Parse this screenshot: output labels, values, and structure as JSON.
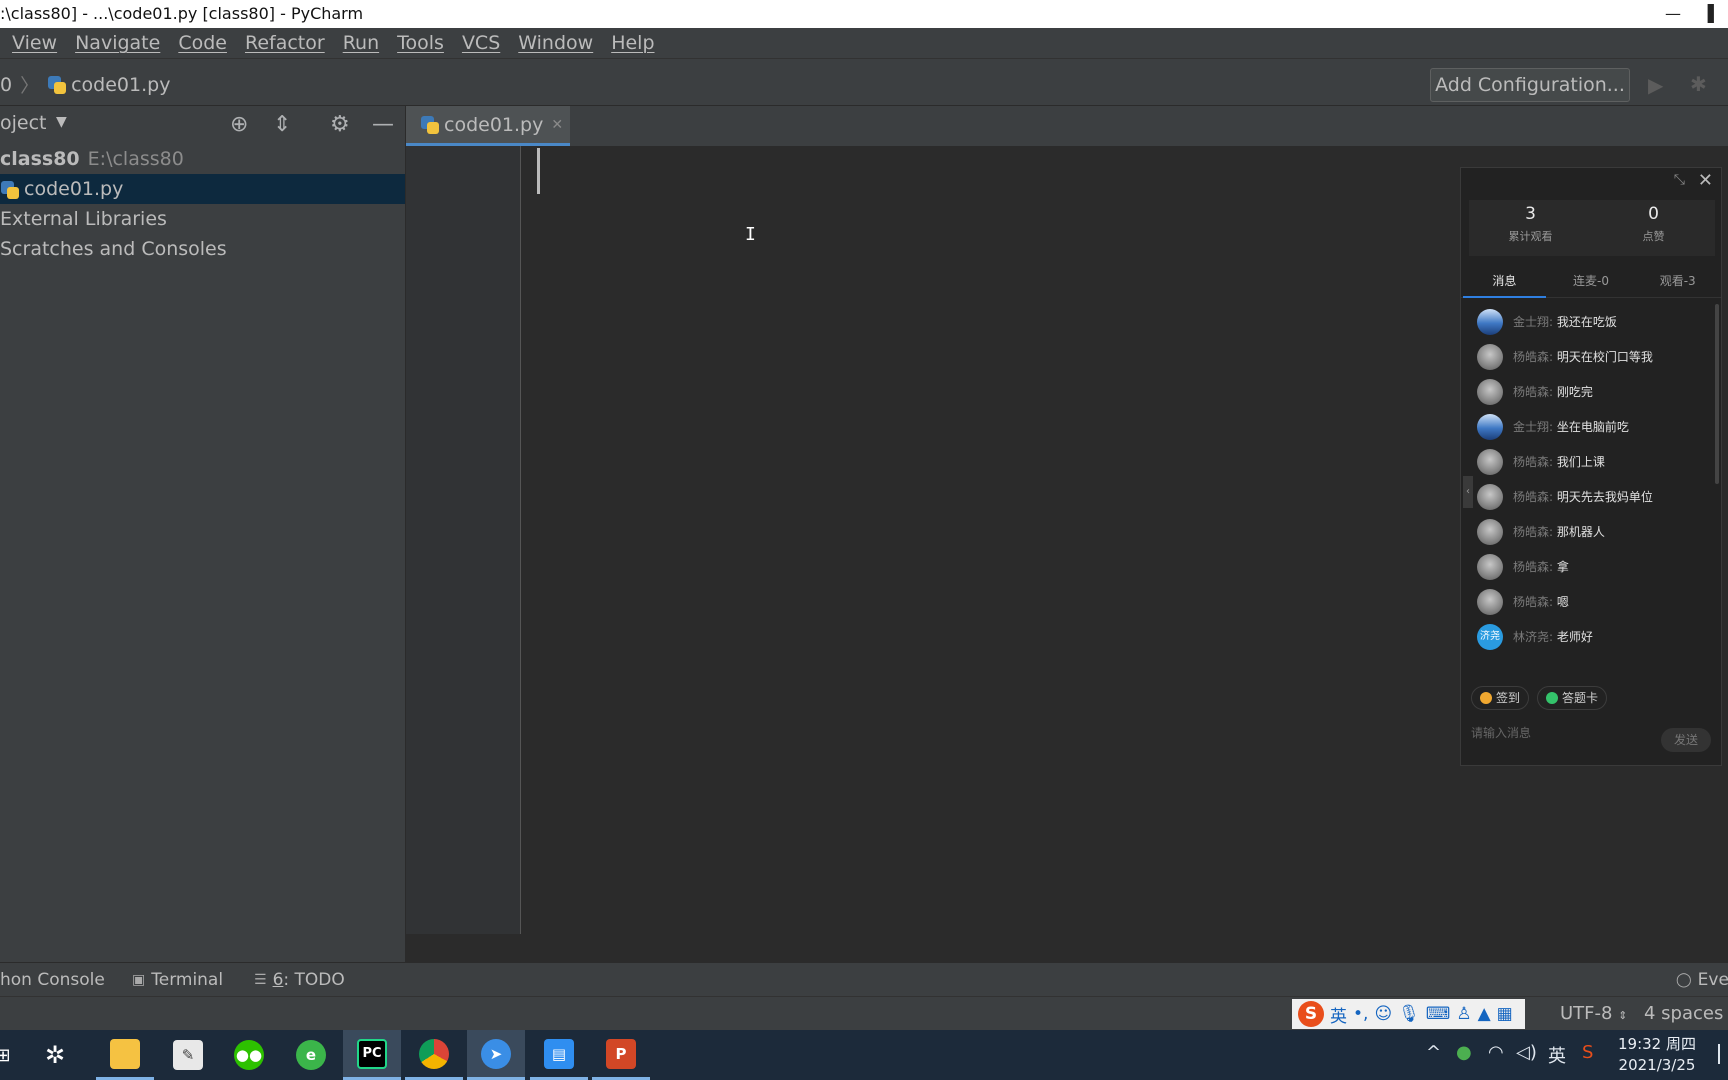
{
  "window": {
    "title": ":\\class80] - ...\\code01.py [class80] - PyCharm",
    "minimize": "—",
    "maximize": "❐"
  },
  "menu": [
    "View",
    "Navigate",
    "Code",
    "Refactor",
    "Run",
    "Tools",
    "VCS",
    "Window",
    "Help"
  ],
  "navbar": {
    "crumb_root": "0",
    "crumb_sep": "〉",
    "crumb_file": "code01.py",
    "add_configuration": "Add Configuration..."
  },
  "project": {
    "title": "oject",
    "root_name": "class80",
    "root_path": "E:\\class80",
    "items": [
      "code01.py",
      "External Libraries",
      "Scratches and Consoles"
    ]
  },
  "editor": {
    "tab_label": "code01.py"
  },
  "live": {
    "stats": [
      {
        "value": "3",
        "label": "累计观看"
      },
      {
        "value": "0",
        "label": "点赞"
      }
    ],
    "tabs": [
      "消息",
      "连麦-0",
      "观看-3"
    ],
    "messages": [
      {
        "sender": "金士翔:",
        "text": "我还在吃饭",
        "avatar": "blue"
      },
      {
        "sender": "杨皓森:",
        "text": "明天在校门口等我",
        "avatar": "gray"
      },
      {
        "sender": "杨皓森:",
        "text": "刚吃完",
        "avatar": "gray"
      },
      {
        "sender": "金士翔:",
        "text": "坐在电脑前吃",
        "avatar": "blue"
      },
      {
        "sender": "杨皓森:",
        "text": "我们上课",
        "avatar": "gray"
      },
      {
        "sender": "杨皓森:",
        "text": "明天先去我妈单位",
        "avatar": "gray"
      },
      {
        "sender": "杨皓森:",
        "text": "那机器人",
        "avatar": "gray"
      },
      {
        "sender": "杨皓森:",
        "text": "拿",
        "avatar": "gray"
      },
      {
        "sender": "杨皓森:",
        "text": "嗯",
        "avatar": "gray"
      },
      {
        "sender": "林济尧:",
        "text": "老师好",
        "avatar": "cyan",
        "avatar_text": "济尧"
      }
    ],
    "actions": [
      {
        "label": "签到",
        "color": "#f0a830"
      },
      {
        "label": "答题卡",
        "color": "#34c36b"
      }
    ],
    "input_placeholder": "请输入消息",
    "send_label": "发送"
  },
  "toolwindows": {
    "python_console": "hon Console",
    "terminal": "Terminal",
    "todo_num": "6",
    "todo_label": ": TODO",
    "event_log": "Eve"
  },
  "status": {
    "ime_lang": "英",
    "encoding": "UTF-8",
    "indent": "4 spaces"
  },
  "taskbar": {
    "tray_lang": "英",
    "time": "19:32 周四",
    "date": "2021/3/25"
  }
}
